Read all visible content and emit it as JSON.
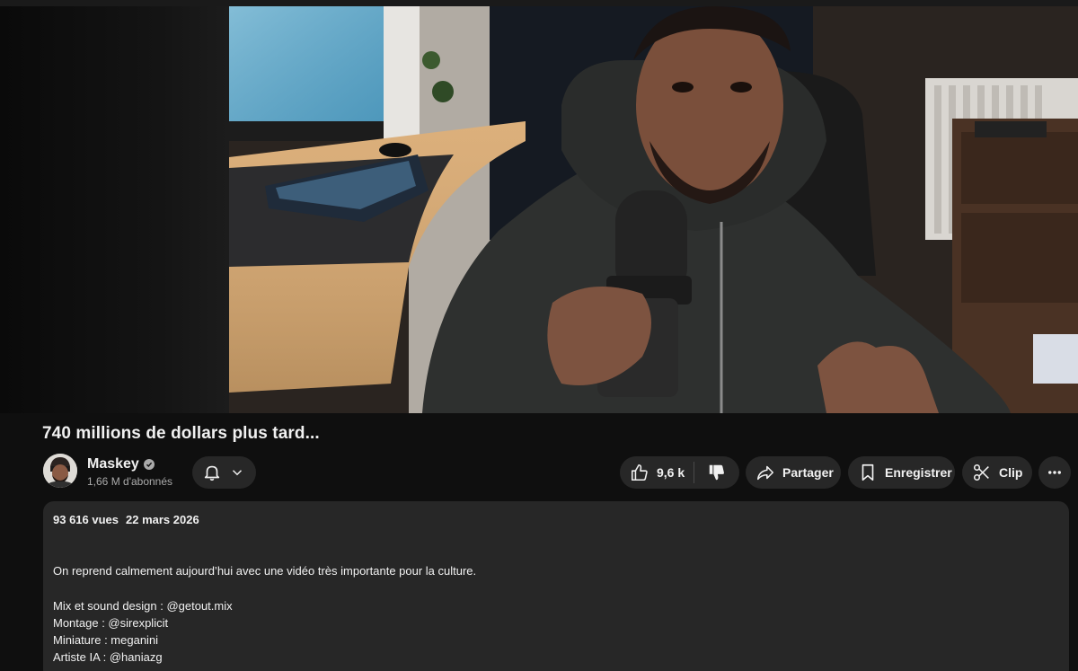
{
  "video": {
    "title": "740 millions de dollars plus tard..."
  },
  "channel": {
    "name": "Maskey",
    "subscribers": "1,66 M d'abonnés",
    "verified": true
  },
  "actions": {
    "likes": "9,6 k",
    "share_label": "Partager",
    "save_label": "Enregistrer",
    "clip_label": "Clip"
  },
  "description": {
    "views": "93 616 vues",
    "date": "22 mars 2026",
    "intro": "On reprend calmement aujourd’hui avec une vidéo très importante pour la culture.",
    "credits": [
      "Mix et sound design : @getout.mix",
      "Montage : @sirexplicit",
      "Miniature : meganini",
      "Artiste IA : @haniazg"
    ]
  },
  "icons": {
    "bell": "bell-icon",
    "chevron": "chevron-down-icon",
    "like": "thumbs-up-icon",
    "dislike": "thumbs-down-icon",
    "share": "share-icon",
    "save": "bookmark-icon",
    "clip": "scissors-icon",
    "more": "more-horiz-icon",
    "verified": "verified-check-icon"
  },
  "colors": {
    "background": "#0f0f0f",
    "pill": "#272727",
    "text": "#f1f1f1",
    "secondary_text": "#aaaaaa"
  }
}
